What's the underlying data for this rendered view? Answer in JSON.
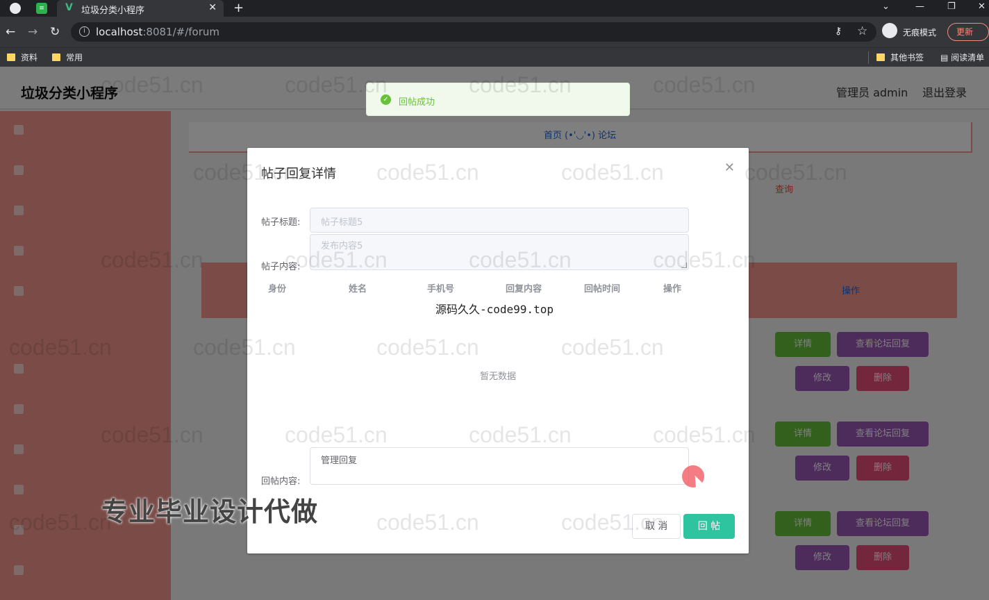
{
  "browser": {
    "tab_title": "垃圾分类小程序",
    "url_host": "localhost",
    "url_rest": ":8081/#/forum",
    "incognito_label": "无痕模式",
    "update_label": "更新",
    "bookmarks": [
      "资料",
      "常用"
    ],
    "bookmarks_right": [
      "其他书签",
      "阅读清单"
    ]
  },
  "app": {
    "title": "垃圾分类小程序",
    "user": "管理员 admin",
    "logout": "退出登录",
    "breadcrumb": "首页 (•'◡'•) 论坛",
    "query": "查询",
    "table_op": "操作",
    "buttons": {
      "detail": "详情",
      "view_reply": "查看论坛回复",
      "edit": "修改",
      "delete": "删除"
    }
  },
  "toast": {
    "text": "回帖成功",
    "color": "#67c23a"
  },
  "dialog": {
    "title": "帖子回复详情",
    "post_title_label": "帖子标题:",
    "post_title_value": "帖子标题5",
    "post_content_label": "帖子内容:",
    "post_content_value": "发布内容5",
    "columns": [
      "身份",
      "姓名",
      "手机号",
      "回复内容",
      "回帖时间",
      "操作"
    ],
    "empty_text": "暂无数据",
    "reply_label": "回帖内容:",
    "reply_value": "管理回复",
    "cancel": "取 消",
    "submit": "回 帖",
    "submit_color": "#2ec4a0"
  },
  "overlays": {
    "center_watermark": "源码久久-code99.top",
    "ad_text": "专业毕业设计代做",
    "repeat_watermark": "code51.cn"
  },
  "icons": [
    "globe-icon",
    "close-icon",
    "plus-icon",
    "back-icon",
    "forward-icon",
    "reload-icon",
    "info-icon",
    "key-icon",
    "star-icon",
    "incognito-icon",
    "folder-icon",
    "success-icon",
    "cursor-icon"
  ]
}
